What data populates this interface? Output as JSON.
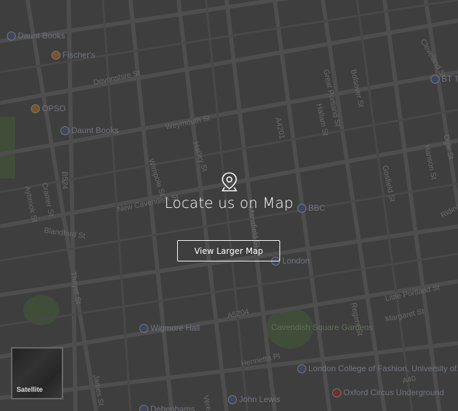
{
  "cta": {
    "title": "Locate us on Map",
    "button_label": "View Larger Map",
    "pin_icon": "map-pin-icon"
  },
  "satellite": {
    "label": "Satellite"
  },
  "colors": {
    "road": "#7d7d7d",
    "block": "#5c5c5c",
    "park": "#5e7a4e",
    "label": "#b9b9b9",
    "overlay": "rgba(40,40,40,0.55)"
  },
  "map": {
    "street_labels": [
      {
        "text": "Wimpole St",
        "rot": 72
      },
      {
        "text": "Harley St",
        "rot": 72
      },
      {
        "text": "Mansfield St",
        "rot": 80
      },
      {
        "text": "Great Portland St",
        "rot": 78
      },
      {
        "text": "Bolsover St",
        "rot": 78
      },
      {
        "text": "Hallam St",
        "rot": 78
      },
      {
        "text": "Weymouth St",
        "rot": -12
      },
      {
        "text": "New Cavendish St",
        "rot": -12
      },
      {
        "text": "Devonshire St",
        "rot": -12
      },
      {
        "text": "Blandford St",
        "rot": 8
      },
      {
        "text": "Thayer St",
        "rot": 80
      },
      {
        "text": "A5204",
        "rot": -12
      },
      {
        "text": "Henrietta Pl",
        "rot": -12
      },
      {
        "text": "Margaret St",
        "rot": -12
      },
      {
        "text": "Little Portland St",
        "rot": -12
      },
      {
        "text": "Regent St",
        "rot": 78
      },
      {
        "text": "A4201",
        "rot": 78
      },
      {
        "text": "B524",
        "rot": 90
      },
      {
        "text": "Aybrook St",
        "rot": 78
      },
      {
        "text": "Cramer St",
        "rot": 78
      },
      {
        "text": "Gosfield St",
        "rot": 78
      },
      {
        "text": "Hanson St",
        "rot": 78
      },
      {
        "text": "Riding House St",
        "rot": -30
      },
      {
        "text": "Cleveland St",
        "rot": 60
      },
      {
        "text": "James St",
        "rot": 80
      },
      {
        "text": "Vere St",
        "rot": 78
      },
      {
        "text": "A40",
        "rot": -12
      },
      {
        "text": "Ogle St",
        "rot": 78
      }
    ],
    "poi_labels": [
      {
        "text": "Daunt Books",
        "kind": "shop"
      },
      {
        "text": "Fischer's",
        "kind": "food"
      },
      {
        "text": "OPSO",
        "kind": "food"
      },
      {
        "text": "Daunt Books",
        "kind": "shop"
      },
      {
        "text": "BBC",
        "kind": "poi"
      },
      {
        "text": "Wigmore Hall",
        "kind": "music"
      },
      {
        "text": "Cavendish Square Gardens",
        "kind": "park"
      },
      {
        "text": "London College of Fashion, University of...",
        "kind": "school"
      },
      {
        "text": "John Lewis",
        "kind": "shop"
      },
      {
        "text": "Debenhams",
        "kind": "shop"
      },
      {
        "text": "Oxford Circus Underground",
        "kind": "transit"
      },
      {
        "text": "BT Tower",
        "kind": "poi"
      },
      {
        "text": "London",
        "kind": "poi"
      }
    ]
  }
}
